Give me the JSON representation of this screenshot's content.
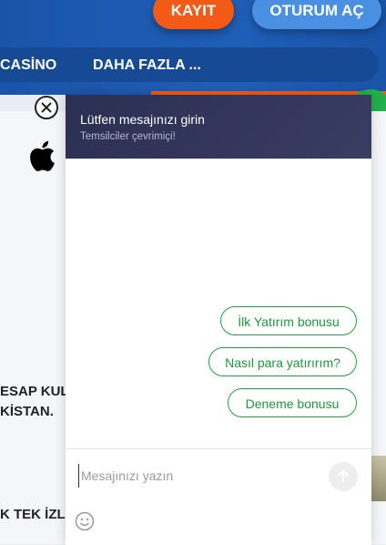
{
  "header": {
    "register_label": "KAYIT",
    "login_label": "OTURUM AÇ"
  },
  "nav": {
    "items": [
      "CASİNO",
      "DAHA FAZLA ..."
    ]
  },
  "background": {
    "line1": "ESAP KULL",
    "line2": "KİSTAN.",
    "line3": "K TEK İZLE"
  },
  "chat": {
    "title": "Lütfen mesajınızı girin",
    "status": "Temsilciler çevrimiçi!",
    "quick_replies": [
      "İlk Yatırım bonusu",
      "Nasıl para yatırırım?",
      "Deneme bonusu"
    ],
    "input_placeholder": "Mesajınızı yazın"
  },
  "colors": {
    "brand_blue": "#1f5fb8",
    "register_orange": "#f25a16",
    "chat_header": "#2b2f52",
    "quick_reply_green": "#1fa33d"
  },
  "icons": [
    "apple-icon",
    "close-icon",
    "send-arrow-icon",
    "emoji-icon"
  ]
}
